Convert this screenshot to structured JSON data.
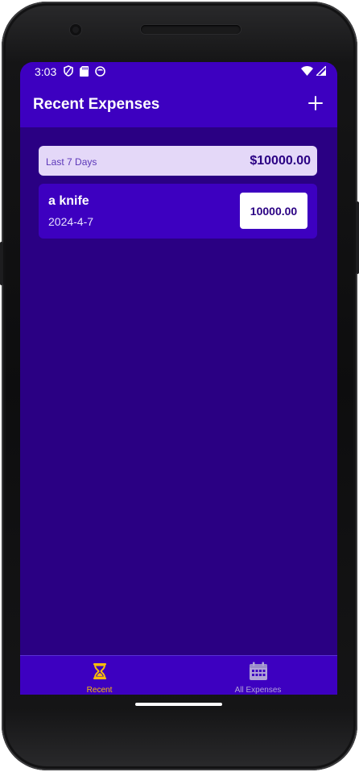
{
  "status_bar": {
    "time": "3:03",
    "icons_left": [
      "shield-icon",
      "sd-card-icon",
      "app-notification-icon"
    ],
    "icons_right": [
      "wifi-icon",
      "cell-signal-icon"
    ]
  },
  "app_bar": {
    "title": "Recent Expenses",
    "add_icon": "plus-icon"
  },
  "summary": {
    "period": "Last 7 Days",
    "total": "$10000.00"
  },
  "expenses": [
    {
      "description": "a knife",
      "date": "2024-4-7",
      "amount": "10000.00"
    }
  ],
  "bottom_nav": {
    "tabs": [
      {
        "label": "Recent",
        "icon": "hourglass-icon",
        "active": true
      },
      {
        "label": "All Expenses",
        "icon": "calendar-icon",
        "active": false
      }
    ]
  },
  "colors": {
    "primary": "#3d00c0",
    "background": "#2a0083",
    "summary_bg": "#e4d8f8",
    "accent": "#f7bc0c",
    "inactive": "#b1a3d8"
  }
}
